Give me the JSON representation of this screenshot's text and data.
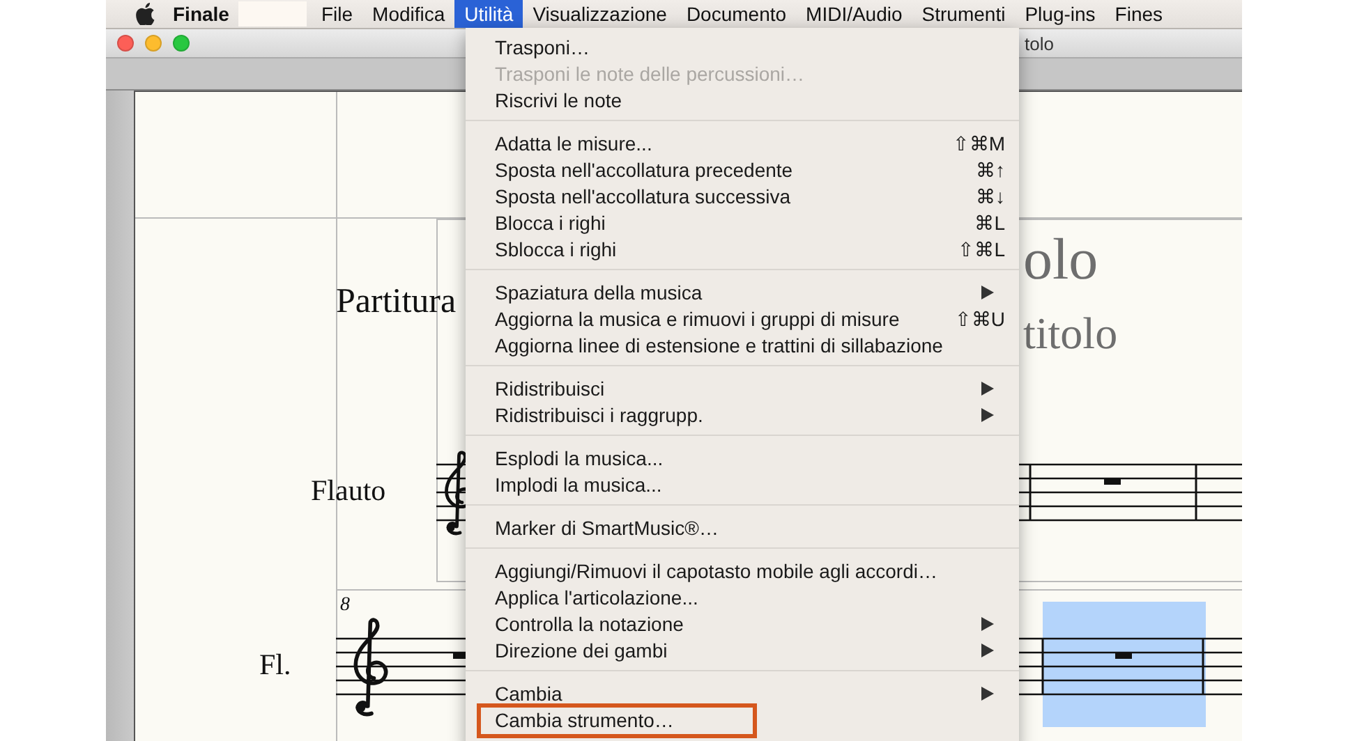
{
  "menu_bar": {
    "app_name": "Finale",
    "items": [
      {
        "label": "File",
        "selected": false
      },
      {
        "label": "Modifica",
        "selected": false
      },
      {
        "label": "Utilità",
        "selected": true
      },
      {
        "label": "Visualizzazione",
        "selected": false
      },
      {
        "label": "Documento",
        "selected": false
      },
      {
        "label": "MIDI/Audio",
        "selected": false
      },
      {
        "label": "Strumenti",
        "selected": false
      },
      {
        "label": "Plug-ins",
        "selected": false
      },
      {
        "label": "Fines",
        "selected": false
      }
    ]
  },
  "window": {
    "title": "tolo"
  },
  "score": {
    "title": "olo",
    "subtitle": "titolo",
    "part_label": "Partitura",
    "staves": [
      {
        "name": "Flauto",
        "selected_measure": false
      },
      {
        "name": "Fl.",
        "measure_number": "8",
        "selected_measure": true
      }
    ]
  },
  "dropdown": {
    "groups": [
      {
        "items": [
          {
            "label": "Trasponi…",
            "disabled": false,
            "submenu": false,
            "outlined": false
          },
          {
            "label": "Trasponi le note delle percussioni…",
            "disabled": true,
            "submenu": false,
            "outlined": false
          },
          {
            "label": "Riscrivi le note",
            "disabled": false,
            "submenu": false,
            "outlined": false
          }
        ]
      },
      {
        "items": [
          {
            "label": "Adatta le misure...",
            "shortcut": "⇧⌘M",
            "disabled": false,
            "submenu": false,
            "outlined": false
          },
          {
            "label": "Sposta nell'accollatura precedente",
            "shortcut": "⌘↑",
            "disabled": false,
            "submenu": false,
            "outlined": false
          },
          {
            "label": "Sposta nell'accollatura successiva",
            "shortcut": "⌘↓",
            "disabled": false,
            "submenu": false,
            "outlined": false
          },
          {
            "label": "Blocca i righi",
            "shortcut": "⌘L",
            "disabled": false,
            "submenu": false,
            "outlined": false
          },
          {
            "label": "Sblocca i righi",
            "shortcut": "⇧⌘L",
            "disabled": false,
            "submenu": false,
            "outlined": false
          }
        ]
      },
      {
        "items": [
          {
            "label": "Spaziatura della musica",
            "disabled": false,
            "submenu": true,
            "outlined": false
          },
          {
            "label": "Aggiorna la musica e rimuovi i gruppi di misure",
            "shortcut": "⇧⌘U",
            "disabled": false,
            "submenu": false,
            "outlined": false
          },
          {
            "label": "Aggiorna linee di estensione e trattini di sillabazione",
            "disabled": false,
            "submenu": false,
            "outlined": false
          }
        ]
      },
      {
        "items": [
          {
            "label": "Ridistribuisci",
            "disabled": false,
            "submenu": true,
            "outlined": false
          },
          {
            "label": "Ridistribuisci i raggrupp.",
            "disabled": false,
            "submenu": true,
            "outlined": false
          }
        ]
      },
      {
        "items": [
          {
            "label": "Esplodi la musica...",
            "disabled": false,
            "submenu": false,
            "outlined": false
          },
          {
            "label": "Implodi la musica...",
            "disabled": false,
            "submenu": false,
            "outlined": false
          }
        ]
      },
      {
        "items": [
          {
            "label": "Marker di SmartMusic®…",
            "disabled": false,
            "submenu": false,
            "outlined": false
          }
        ]
      },
      {
        "items": [
          {
            "label": "Aggiungi/Rimuovi il capotasto mobile agli accordi…",
            "disabled": false,
            "submenu": false,
            "outlined": false
          },
          {
            "label": "Applica l'articolazione...",
            "disabled": false,
            "submenu": false,
            "outlined": false
          },
          {
            "label": "Controlla la notazione",
            "disabled": false,
            "submenu": true,
            "outlined": false
          },
          {
            "label": "Direzione dei gambi",
            "disabled": false,
            "submenu": true,
            "outlined": false
          }
        ]
      },
      {
        "items": [
          {
            "label": "Cambia",
            "disabled": false,
            "submenu": true,
            "outlined": false
          },
          {
            "label": "Cambia strumento…",
            "disabled": false,
            "submenu": false,
            "outlined": true
          }
        ]
      }
    ]
  }
}
